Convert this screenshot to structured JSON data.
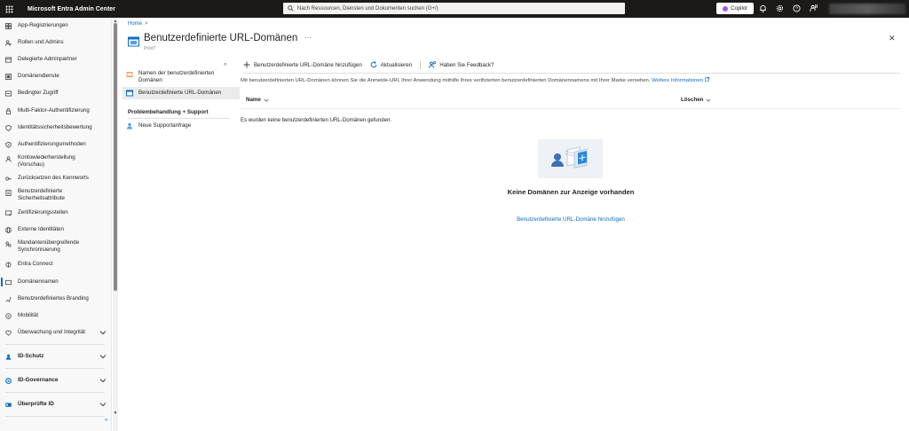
{
  "topbar": {
    "app_title": "Microsoft Entra Admin Center",
    "search_placeholder": "Nach Ressourcen, Diensten und Dokumenten suchen (G+/)",
    "copilot_label": "Copilot"
  },
  "sidebar": {
    "items": [
      {
        "label": "App-Registrierungen",
        "icon": "app-grid-icon"
      },
      {
        "label": "Rollen und Admins",
        "icon": "roles-icon"
      },
      {
        "label": "Delegierte Adminpartner",
        "icon": "partner-icon"
      },
      {
        "label": "Domänendienste",
        "icon": "domain-services-icon"
      },
      {
        "label": "Bedingter Zugriff",
        "icon": "conditional-access-icon"
      },
      {
        "label": "Multi-Faktor-Authentifizierung",
        "icon": "mfa-icon"
      },
      {
        "label": "Identitätssicherheitsbewertung",
        "icon": "security-score-icon"
      },
      {
        "label": "Authentifizierungsmethoden",
        "icon": "auth-methods-icon"
      },
      {
        "label": "Kontowiederherstellung (Vorschau)",
        "icon": "account-recovery-icon"
      },
      {
        "label": "Zurücksetzen des Kennworts",
        "icon": "key-icon"
      },
      {
        "label": "Benutzerdefinierte Sicherheitsattribute",
        "icon": "attributes-icon"
      },
      {
        "label": "Zertifizierungsstellen",
        "icon": "certificate-icon"
      },
      {
        "label": "Externe Identitäten",
        "icon": "external-id-icon"
      },
      {
        "label": "Mandantenübergreifende Synchronisierung",
        "icon": "sync-icon"
      },
      {
        "label": "Entra Connect",
        "icon": "connect-icon"
      },
      {
        "label": "Domänennamen",
        "icon": "domain-names-icon"
      },
      {
        "label": "Benutzerdefiniertes Branding",
        "icon": "branding-icon"
      },
      {
        "label": "Mobilität",
        "icon": "mobility-icon"
      },
      {
        "label": "Überwachung und Integrität",
        "icon": "monitoring-icon"
      }
    ],
    "groups": [
      {
        "label": "ID-Schutz"
      },
      {
        "label": "ID-Governance"
      },
      {
        "label": "Überprüfte ID"
      }
    ],
    "collapse_label": "«"
  },
  "breadcrumb": {
    "home": "Home",
    "separator": ">"
  },
  "page": {
    "title": "Benutzerdefinierte URL-Domänen",
    "more": "···",
    "subtitle": "Print7",
    "close": "✕"
  },
  "leftmenu": {
    "collapse": "«",
    "items": [
      {
        "label": "Namen der benutzerdefinierten Domänen"
      },
      {
        "label": "Benutzerdefinierte URL-Domänen"
      }
    ],
    "section": "Problembehandlung + Support",
    "support_item": "Neue Supportanfrage"
  },
  "toolbar": {
    "add": "Benutzerdefinierte URL-Domäne hinzufügen",
    "refresh": "Aktualisieren",
    "feedback": "Haben Sie Feedback?"
  },
  "info": {
    "text": "Mit benutzerdefinierten URL-Domänen können Sie die Anmelde-URL Ihrer Anwendung mithilfe Ihres verifizierten benutzerdefinierten Domänennamens mit Ihrer Marke versehen.",
    "link": "Weitere Informationen"
  },
  "table": {
    "col_name": "Name",
    "col_delete": "Löschen",
    "empty_message": "Es wurden keine benutzerdefinierten URL-Domänen gefunden."
  },
  "empty_state": {
    "title": "Keine Domänen zur Anzeige vorhanden",
    "link": "Benutzerdefinierte URL-Domäne hinzufügen"
  },
  "colors": {
    "accent": "#0f6cbd",
    "topbar": "#1b1a19"
  }
}
